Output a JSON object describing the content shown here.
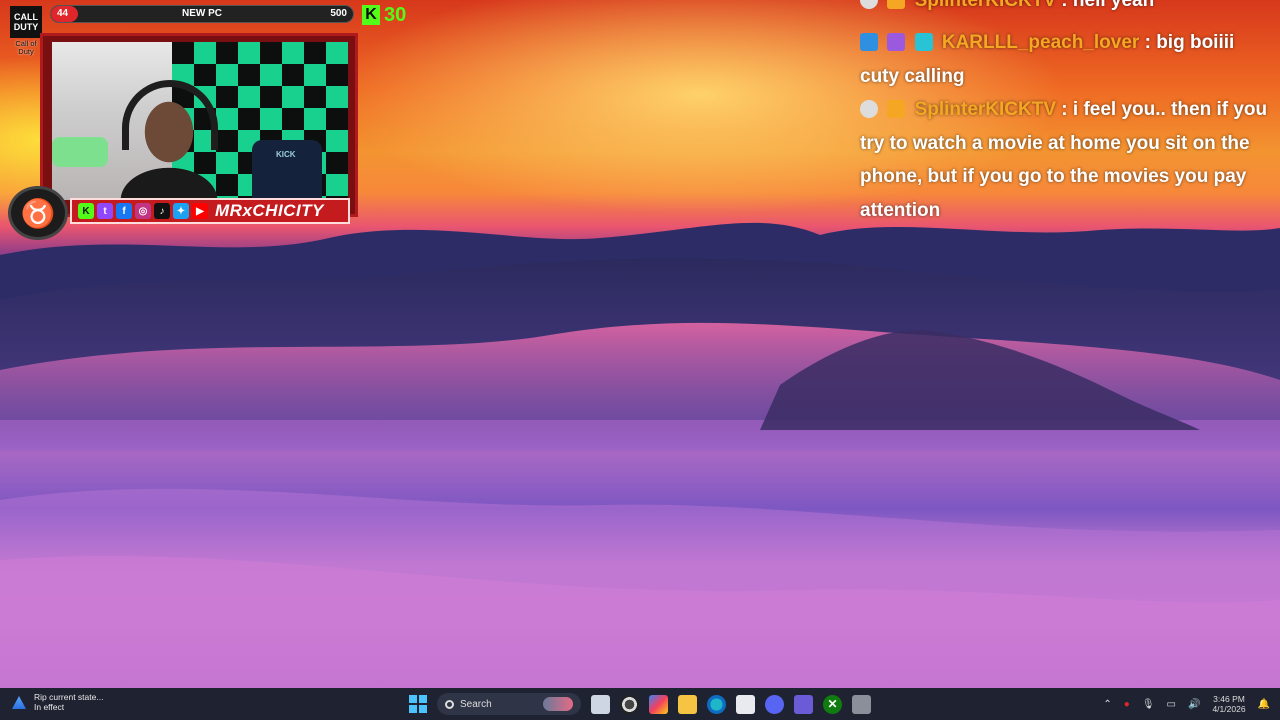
{
  "stream_overlay": {
    "cod_logo_text": "CALL DUTY",
    "cod_label": "Call of Duty",
    "goal": {
      "current": "44",
      "title": "NEW PC",
      "target": "500",
      "progress": 0.088
    },
    "kick_followers": "30",
    "streamer_name": "MRxCHICITY",
    "webcam_chair_label": "KICK",
    "social_icons": [
      "kick-icon",
      "twitch-icon",
      "facebook-icon",
      "instagram-icon",
      "tiktok-icon",
      "twitter-icon",
      "youtube-icon"
    ]
  },
  "chat": {
    "first": {
      "user": "SplinterKICKTV",
      "text": "hell yeah"
    },
    "messages": [
      {
        "user": "KARLLL_peach_lover",
        "text": "big boiiii cuty calling"
      },
      {
        "user": "SplinterKICKTV",
        "text": "i feel you.. then if you try to watch a movie at home you sit on the phone, but if you go to the movies you pay attention"
      }
    ],
    "username_color": "#f5a623"
  },
  "taskbar": {
    "notification_title": "Rip current state...",
    "notification_subtitle": "In effect",
    "search_placeholder": "Search",
    "clock_time": "3:46 PM",
    "clock_date": "4/1/2026"
  },
  "colors": {
    "accent_red": "#e0262b",
    "kick_green": "#53fc18",
    "taskbar_bg": "#1f2331"
  }
}
